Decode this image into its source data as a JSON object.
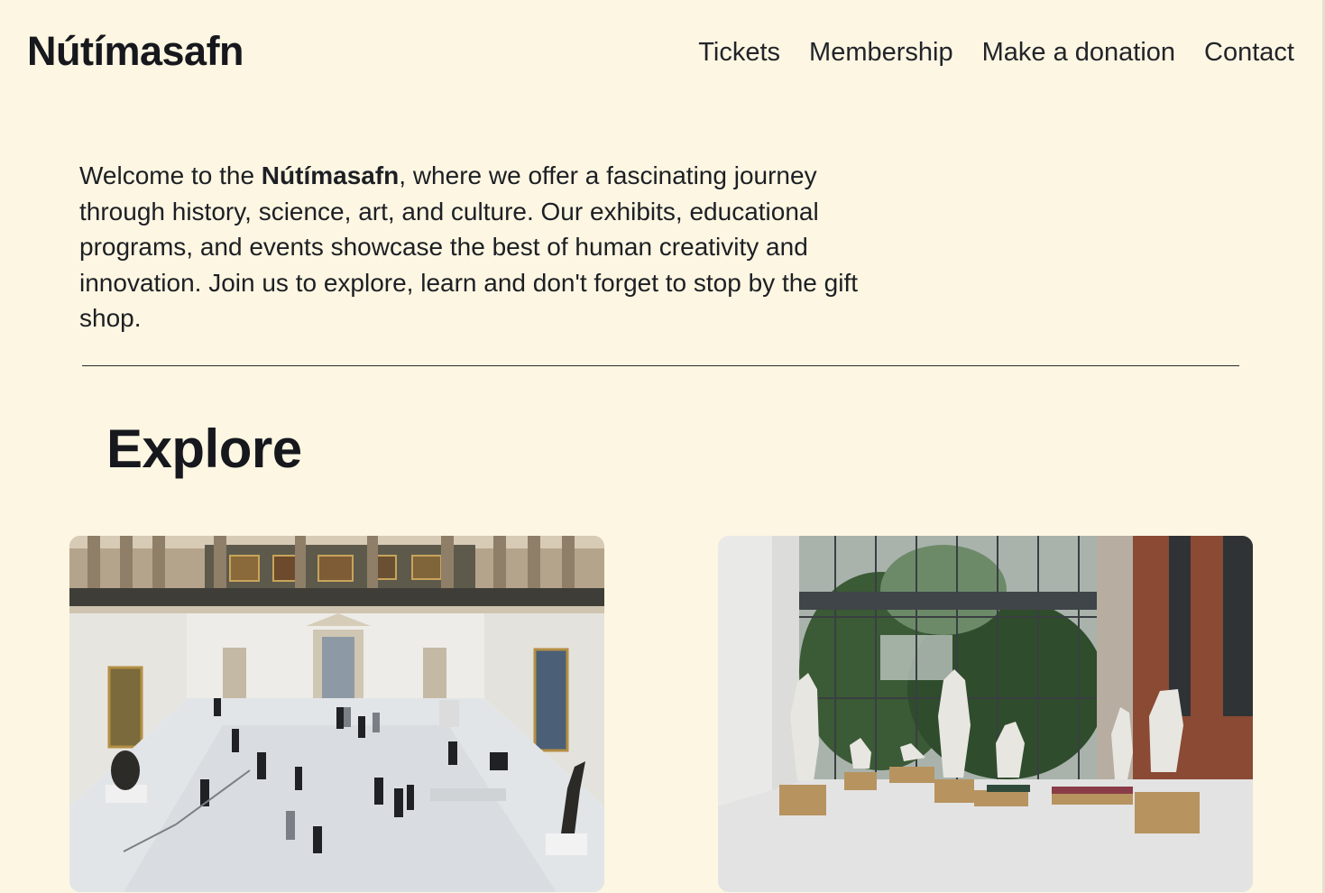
{
  "header": {
    "logo": "Nútímasafn",
    "nav": [
      {
        "label": "Tickets"
      },
      {
        "label": "Membership"
      },
      {
        "label": "Make a donation"
      },
      {
        "label": "Contact"
      }
    ]
  },
  "intro": {
    "prefix": "Welcome to the ",
    "museum_name": "Nútímasafn",
    "suffix": ", where we offer a fascinating journey through history, science, art, and culture. Our exhibits, educational programs, and events showcase the best of human creativity and innovation. Join us to explore, learn and don't forget to stop by the gift shop."
  },
  "explore": {
    "title": "Explore"
  },
  "colors": {
    "background": "#fcf6e2",
    "text": "#16181d"
  }
}
